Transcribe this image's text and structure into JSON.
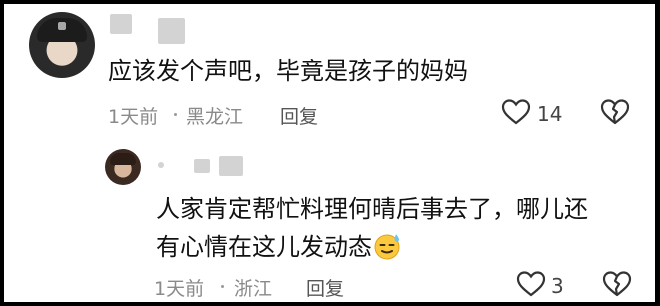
{
  "comments": [
    {
      "text": "应该发个声吧，毕竟是孩子的妈妈",
      "time": "1天前",
      "location": "黑龙江",
      "reply_label": "回复",
      "like_count": "14"
    },
    {
      "line1": "人家肯定帮忙料理何晴后事去了，哪儿还",
      "line2": "有心情在这儿发动态",
      "emoji_icon": "sweat-smile-emoji",
      "time": "1天前",
      "location": "浙江",
      "reply_label": "回复",
      "like_count": "3"
    }
  ],
  "colors": {
    "frame": "#000000",
    "background": "#ffffff",
    "text": "#111111",
    "meta": "#8a8a8a"
  }
}
